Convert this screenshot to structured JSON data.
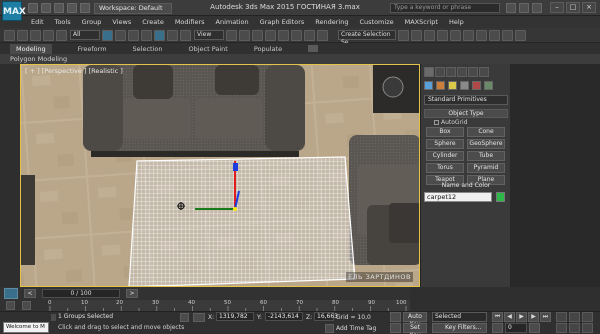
{
  "titlebar": {
    "app_icon": "MAX",
    "workspace": "Workspace: Default",
    "title": "Autodesk 3ds Max 2015    ГОСТИНАЯ 3.max",
    "search_placeholder": "Type a keyword or phrase",
    "window_buttons": [
      "–",
      "□",
      "×"
    ]
  },
  "menu": [
    "Edit",
    "Tools",
    "Group",
    "Views",
    "Create",
    "Modifiers",
    "Animation",
    "Graph Editors",
    "Rendering",
    "Customize",
    "MAXScript",
    "Help"
  ],
  "toolbar": {
    "selection_filter": "All",
    "reference_coord": "View",
    "named_selection": "Create Selection Se"
  },
  "ribbon": {
    "tabs": [
      "Modeling",
      "Freeform",
      "Selection",
      "Object Paint",
      "Populate"
    ],
    "panel": "Polygon Modeling"
  },
  "viewport": {
    "label": "[ + ] [Perspective ] [Realistic ]",
    "watermark": "ЕЛЬ ЗАРТДИНОВ"
  },
  "command_panel": {
    "category": "Standard Primitives",
    "object_type_title": "Object Type",
    "autogrid": "AutoGrid",
    "primitives": [
      "Box",
      "Cone",
      "Sphere",
      "GeoSphere",
      "Cylinder",
      "Tube",
      "Torus",
      "Pyramid",
      "Teapot",
      "Plane"
    ],
    "name_color_title": "Name and Color",
    "object_name": "carpet12",
    "object_color": "#2fb84a"
  },
  "timeline": {
    "frame_counter": "0 / 100",
    "ticks": [
      "0",
      "10",
      "20",
      "30",
      "40",
      "50",
      "60",
      "70",
      "80",
      "90",
      "100"
    ]
  },
  "status": {
    "welcome": "Welcome to M",
    "selection": "1 Groups Selected",
    "prompt": "Click and drag to select and move objects",
    "x_label": "X:",
    "x_value": "1319,782",
    "y_label": "Y:",
    "y_value": "-2143,614",
    "z_label": "Z:",
    "z_value": "16,663",
    "grid": "Grid = 10,0",
    "add_time_tag": "Add Time Tag",
    "auto_key": "Auto Key",
    "set_key": "Set Key",
    "key_mode": "Selected",
    "key_filters": "Key Filters...",
    "frame_field": "0"
  }
}
